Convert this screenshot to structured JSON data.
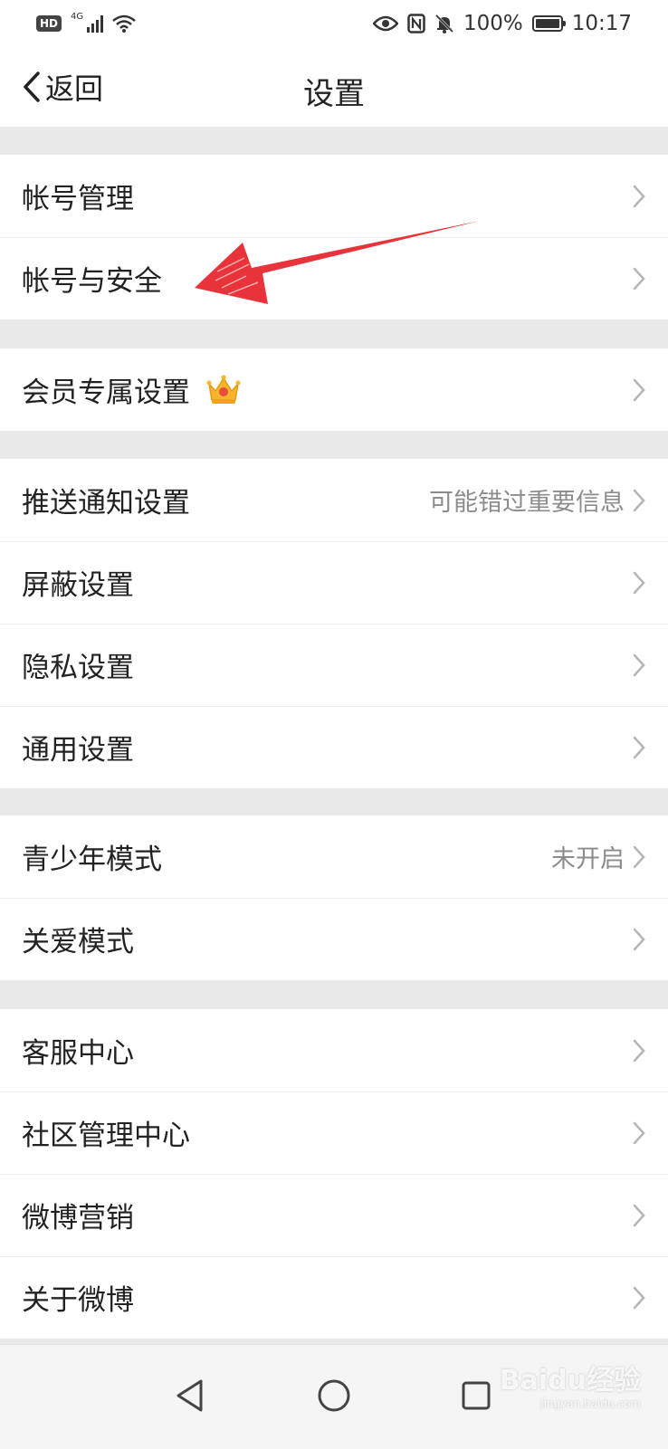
{
  "status_bar": {
    "network": "4G",
    "battery": "100%",
    "time": "10:17"
  },
  "nav": {
    "back_label": "返回",
    "title": "设置"
  },
  "groups": [
    {
      "items": [
        {
          "label": "帐号管理",
          "hint": ""
        },
        {
          "label": "帐号与安全",
          "hint": ""
        }
      ]
    },
    {
      "items": [
        {
          "label": "会员专属设置",
          "hint": "",
          "icon": "crown-icon"
        }
      ]
    },
    {
      "items": [
        {
          "label": "推送通知设置",
          "hint": "可能错过重要信息"
        },
        {
          "label": "屏蔽设置",
          "hint": ""
        },
        {
          "label": "隐私设置",
          "hint": ""
        },
        {
          "label": "通用设置",
          "hint": ""
        }
      ]
    },
    {
      "items": [
        {
          "label": "青少年模式",
          "hint": "未开启"
        },
        {
          "label": "关爱模式",
          "hint": ""
        }
      ]
    },
    {
      "items": [
        {
          "label": "客服中心",
          "hint": ""
        },
        {
          "label": "社区管理中心",
          "hint": ""
        },
        {
          "label": "微博营销",
          "hint": ""
        },
        {
          "label": "关于微博",
          "hint": ""
        }
      ]
    }
  ],
  "watermark": {
    "brand": "Baidu经验",
    "url": "jingyan.baidu.com"
  },
  "colors": {
    "annotation_arrow": "#e8333a",
    "separator": "#e9e9e9",
    "hint_text": "#8c8c8c"
  }
}
